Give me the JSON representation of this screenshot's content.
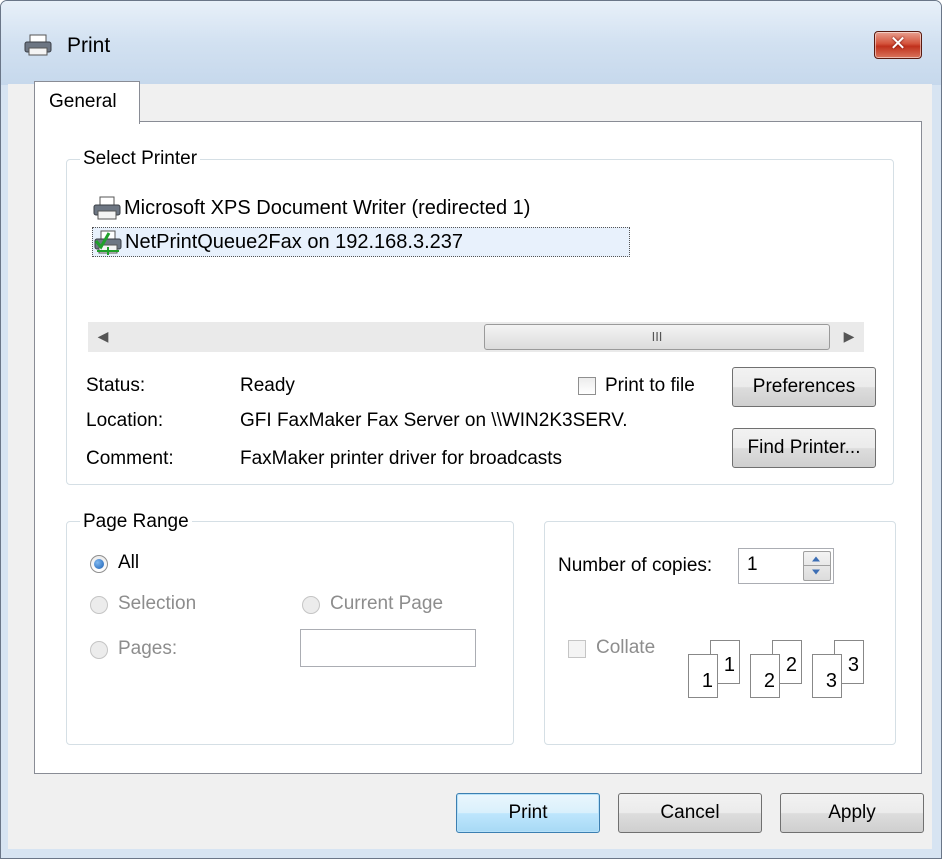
{
  "window": {
    "title": "Print",
    "close_glyph": "✕"
  },
  "tabs": [
    {
      "label": "General"
    }
  ],
  "select_printer": {
    "legend": "Select Printer",
    "printers": [
      {
        "name": "Microsoft XPS Document Writer (redirected 1)",
        "icon": "printer-icon",
        "selected": false
      },
      {
        "name": "NetPrintQueue2Fax on 192.168.3.237",
        "icon": "network-printer-icon",
        "selected": true
      }
    ],
    "scroll": {
      "left_arrow": "◀",
      "right_arrow": "▶",
      "grip": "III"
    },
    "status_label": "Status:",
    "status_value": "Ready",
    "location_label": "Location:",
    "location_value": "GFI FaxMaker Fax Server on \\\\WIN2K3SERV.",
    "comment_label": "Comment:",
    "comment_value": "FaxMaker printer driver for broadcasts",
    "print_to_file_label": "Print to file",
    "print_to_file_checked": false,
    "preferences_label": "Preferences",
    "find_printer_label": "Find Printer..."
  },
  "page_range": {
    "legend": "Page Range",
    "all_label": "All",
    "selection_label": "Selection",
    "current_page_label": "Current Page",
    "pages_label": "Pages:",
    "pages_value": "",
    "selected_option": "All"
  },
  "copies": {
    "number_label": "Number of copies:",
    "number_value": "1",
    "collate_label": "Collate",
    "collate_checked": false,
    "collate_illustration": [
      {
        "back": "1",
        "front": "1"
      },
      {
        "back": "2",
        "front": "2"
      },
      {
        "back": "3",
        "front": "3"
      }
    ]
  },
  "buttons": {
    "print": "Print",
    "cancel": "Cancel",
    "apply": "Apply"
  },
  "colors": {
    "title_bar": "#d2e1f1",
    "close_button": "#c9442b",
    "selected_row": "#e8f1fc",
    "radio_selected": "#1a5fb4"
  }
}
